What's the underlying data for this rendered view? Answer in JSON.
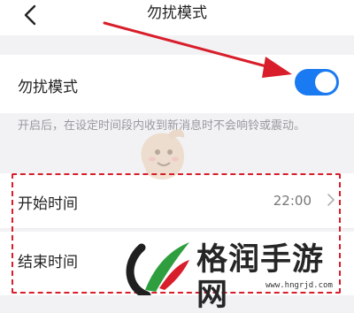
{
  "header": {
    "title": "勿扰模式",
    "back_icon": "back-chevron-icon"
  },
  "dnd": {
    "label": "勿扰模式",
    "enabled": true,
    "toggle_color": "#1a7af2",
    "description": "开启后，在设定时间段内收到新消息时不会响铃或震动。"
  },
  "schedule": {
    "start_label": "开始时间",
    "start_value": "22:00",
    "end_label": "结束时间",
    "chevron_icon": "chevron-right-icon",
    "highlight_color": "#d81e2b"
  },
  "annotation": {
    "arrow_color": "#d81e2b"
  },
  "watermark": {
    "name": "格润手游网",
    "url": "www.hngrjd.com"
  }
}
